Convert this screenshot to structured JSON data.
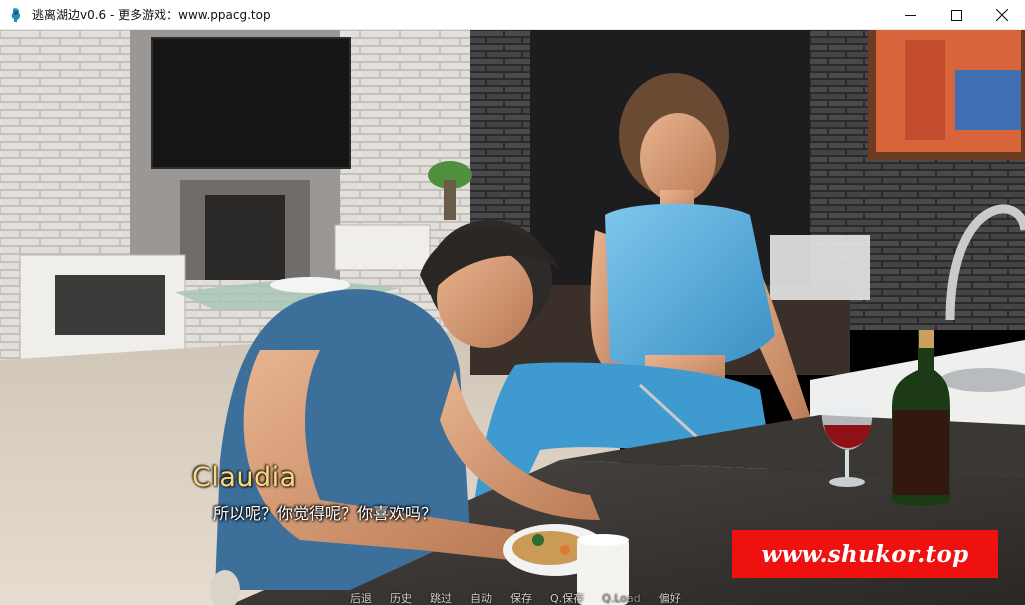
{
  "window": {
    "title": "逃离湖边v0.6 - 更多游戏：www.ppacg.top",
    "icon": "app-icon",
    "controls": [
      "minimize-icon",
      "maximize-icon",
      "close-icon"
    ]
  },
  "dialogue": {
    "speaker": "Claudia",
    "text": "所以呢？你觉得呢？你喜欢吗？",
    "speaker_color": "#f5d98a"
  },
  "watermark": {
    "text": "www.shukor.top",
    "bg_color": "#ef1010"
  },
  "quick_menu": {
    "items": [
      "后退",
      "历史",
      "跳过",
      "自动",
      "保存",
      "Q.保存",
      "Q.Load",
      "偏好"
    ]
  }
}
